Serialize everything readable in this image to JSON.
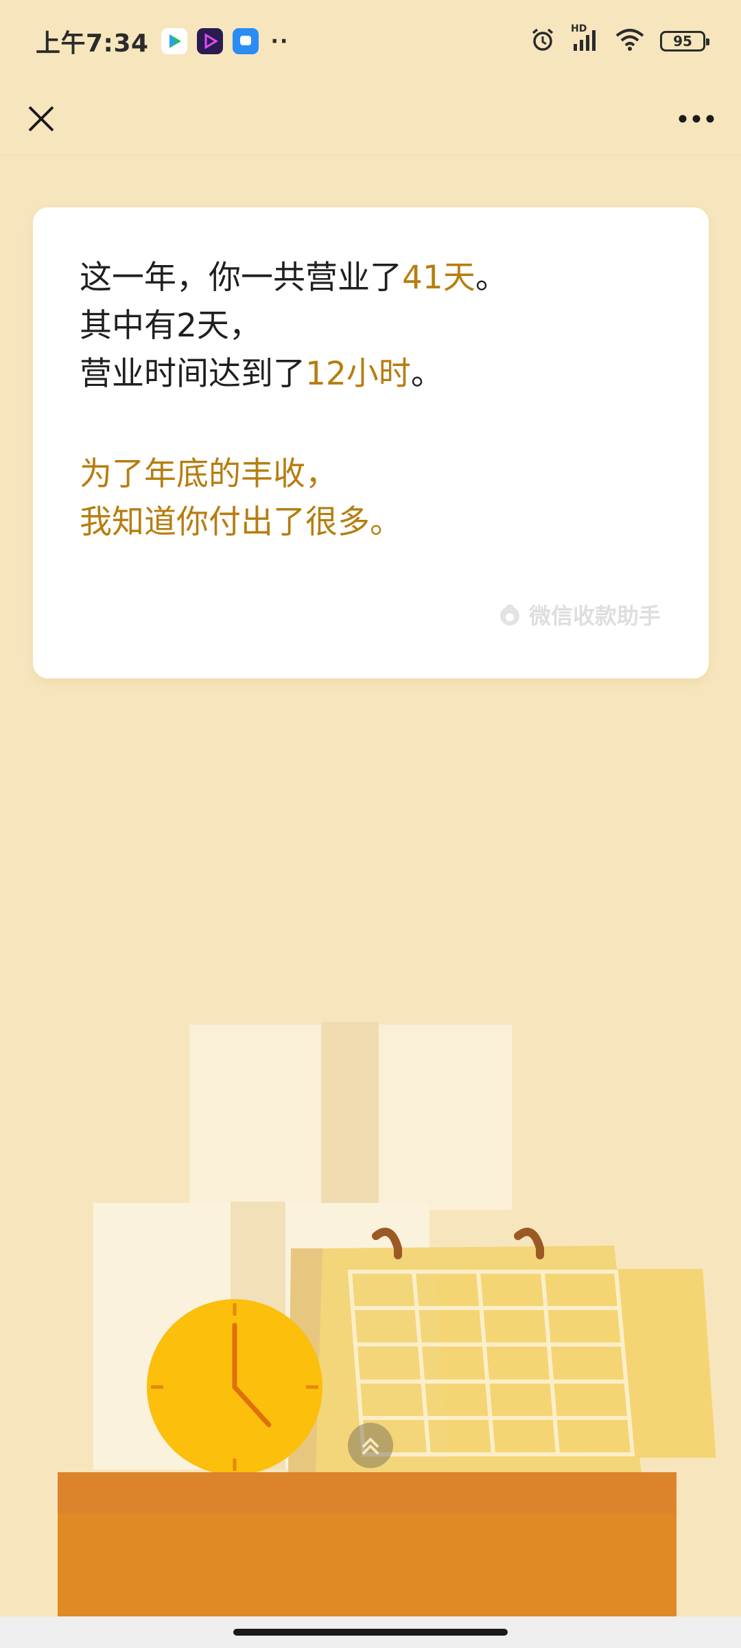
{
  "status_bar": {
    "time": "上午7:34",
    "battery": "95",
    "network_label": "HD",
    "more_notifications": "··"
  },
  "nav": {
    "close_icon": "close-icon",
    "more_icon": "more-icon"
  },
  "card": {
    "line1_prefix": "这一年，你一共营业了",
    "line1_highlight": "41天",
    "line1_suffix": "。",
    "line2": "其中有2天，",
    "line3_prefix": "营业时间达到了",
    "line3_highlight": "12小时",
    "line3_suffix": "。",
    "line4": "为了年底的丰收，",
    "line5": "我知道你付出了很多。",
    "watermark": "微信收款助手"
  },
  "colors": {
    "background": "#f7e6bd",
    "accent": "#b67d10",
    "card": "#ffffff"
  }
}
